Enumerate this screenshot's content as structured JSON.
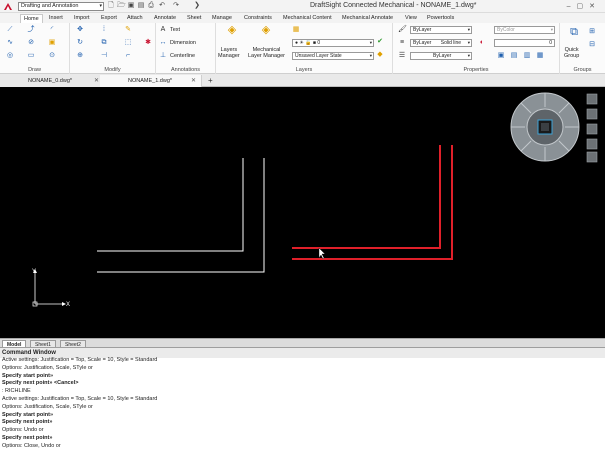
{
  "titlebar": {
    "workspace": "Drafting and Annotation",
    "title": "DraftSight Connected Mechanical - NONAME_1.dwg*"
  },
  "ribbon_tabs": [
    "Home",
    "Insert",
    "Import",
    "Export",
    "Attach",
    "Annotate",
    "Sheet",
    "Manage",
    "Constraints",
    "Mechanical Content",
    "Mechanical Annotate",
    "View",
    "Powertools"
  ],
  "panels": {
    "draw": "Draw",
    "modify": "Modify",
    "annotations": "Annotations",
    "layers": "Layers",
    "properties": "Properties",
    "groups": "Groups"
  },
  "annotations": {
    "text": "Text",
    "dimension": "Dimension",
    "centerline": "Centerline"
  },
  "layers": {
    "manager": "Layers\nManager",
    "mech_manager": "Mechanical\nLayer Manager",
    "current_layer": "0",
    "layer_state": "Unsaved Layer State"
  },
  "properties": {
    "color": "ByLayer",
    "color2": "ByColor",
    "linetype": "ByLayer",
    "linestyle": "Solid line",
    "lineweight": "ByLayer",
    "value": "0"
  },
  "groups": {
    "quick_group": "Quick\nGroup"
  },
  "file_tabs": [
    {
      "label": "NONAME_0.dwg*"
    },
    {
      "label": "NONAME_1.dwg*"
    }
  ],
  "layout_tabs": [
    "Model",
    "Sheet1",
    "Sheet2"
  ],
  "command_window": {
    "title": "Command Window",
    "lines": [
      {
        "text": "Active settings: Justification = Top, Scale = 10, Style = Standard",
        "bold": false
      },
      {
        "text": "Options: Justification, Scale, STyle or",
        "bold": false
      },
      {
        "text": "Specify start point»",
        "bold": true
      },
      {
        "text": "Specify next point» <Cancel>",
        "bold": true
      },
      {
        "text": ": RICHLINE",
        "bold": false
      },
      {
        "text": "Active settings: Justification = Top, Scale = 10, Style = Standard",
        "bold": false
      },
      {
        "text": "Options: Justification, Scale, STyle or",
        "bold": false
      },
      {
        "text": "Specify start point»",
        "bold": true
      },
      {
        "text": "Specify next point»",
        "bold": true
      },
      {
        "text": "Options: Undo or",
        "bold": false
      },
      {
        "text": "Specify next point»",
        "bold": true
      },
      {
        "text": "Options: Close, Undo or",
        "bold": false
      },
      {
        "text": "Specify next point» <Cancel>",
        "bold": true
      }
    ]
  },
  "colors": {
    "canvas": "#000000",
    "white_line": "#ffffff",
    "red_line": "#e0202a",
    "accent_link": "#1b5fbf"
  },
  "icons": {
    "app": "app-logo-icon",
    "new": "new-file-icon",
    "open": "open-file-icon",
    "save": "save-icon",
    "print": "print-icon",
    "undo": "undo-icon",
    "redo": "redo-icon",
    "navwheel": "view-cube-icon",
    "ucs": "ucs-axis-icon"
  },
  "ucs": {
    "x": "X",
    "y": "Y"
  }
}
